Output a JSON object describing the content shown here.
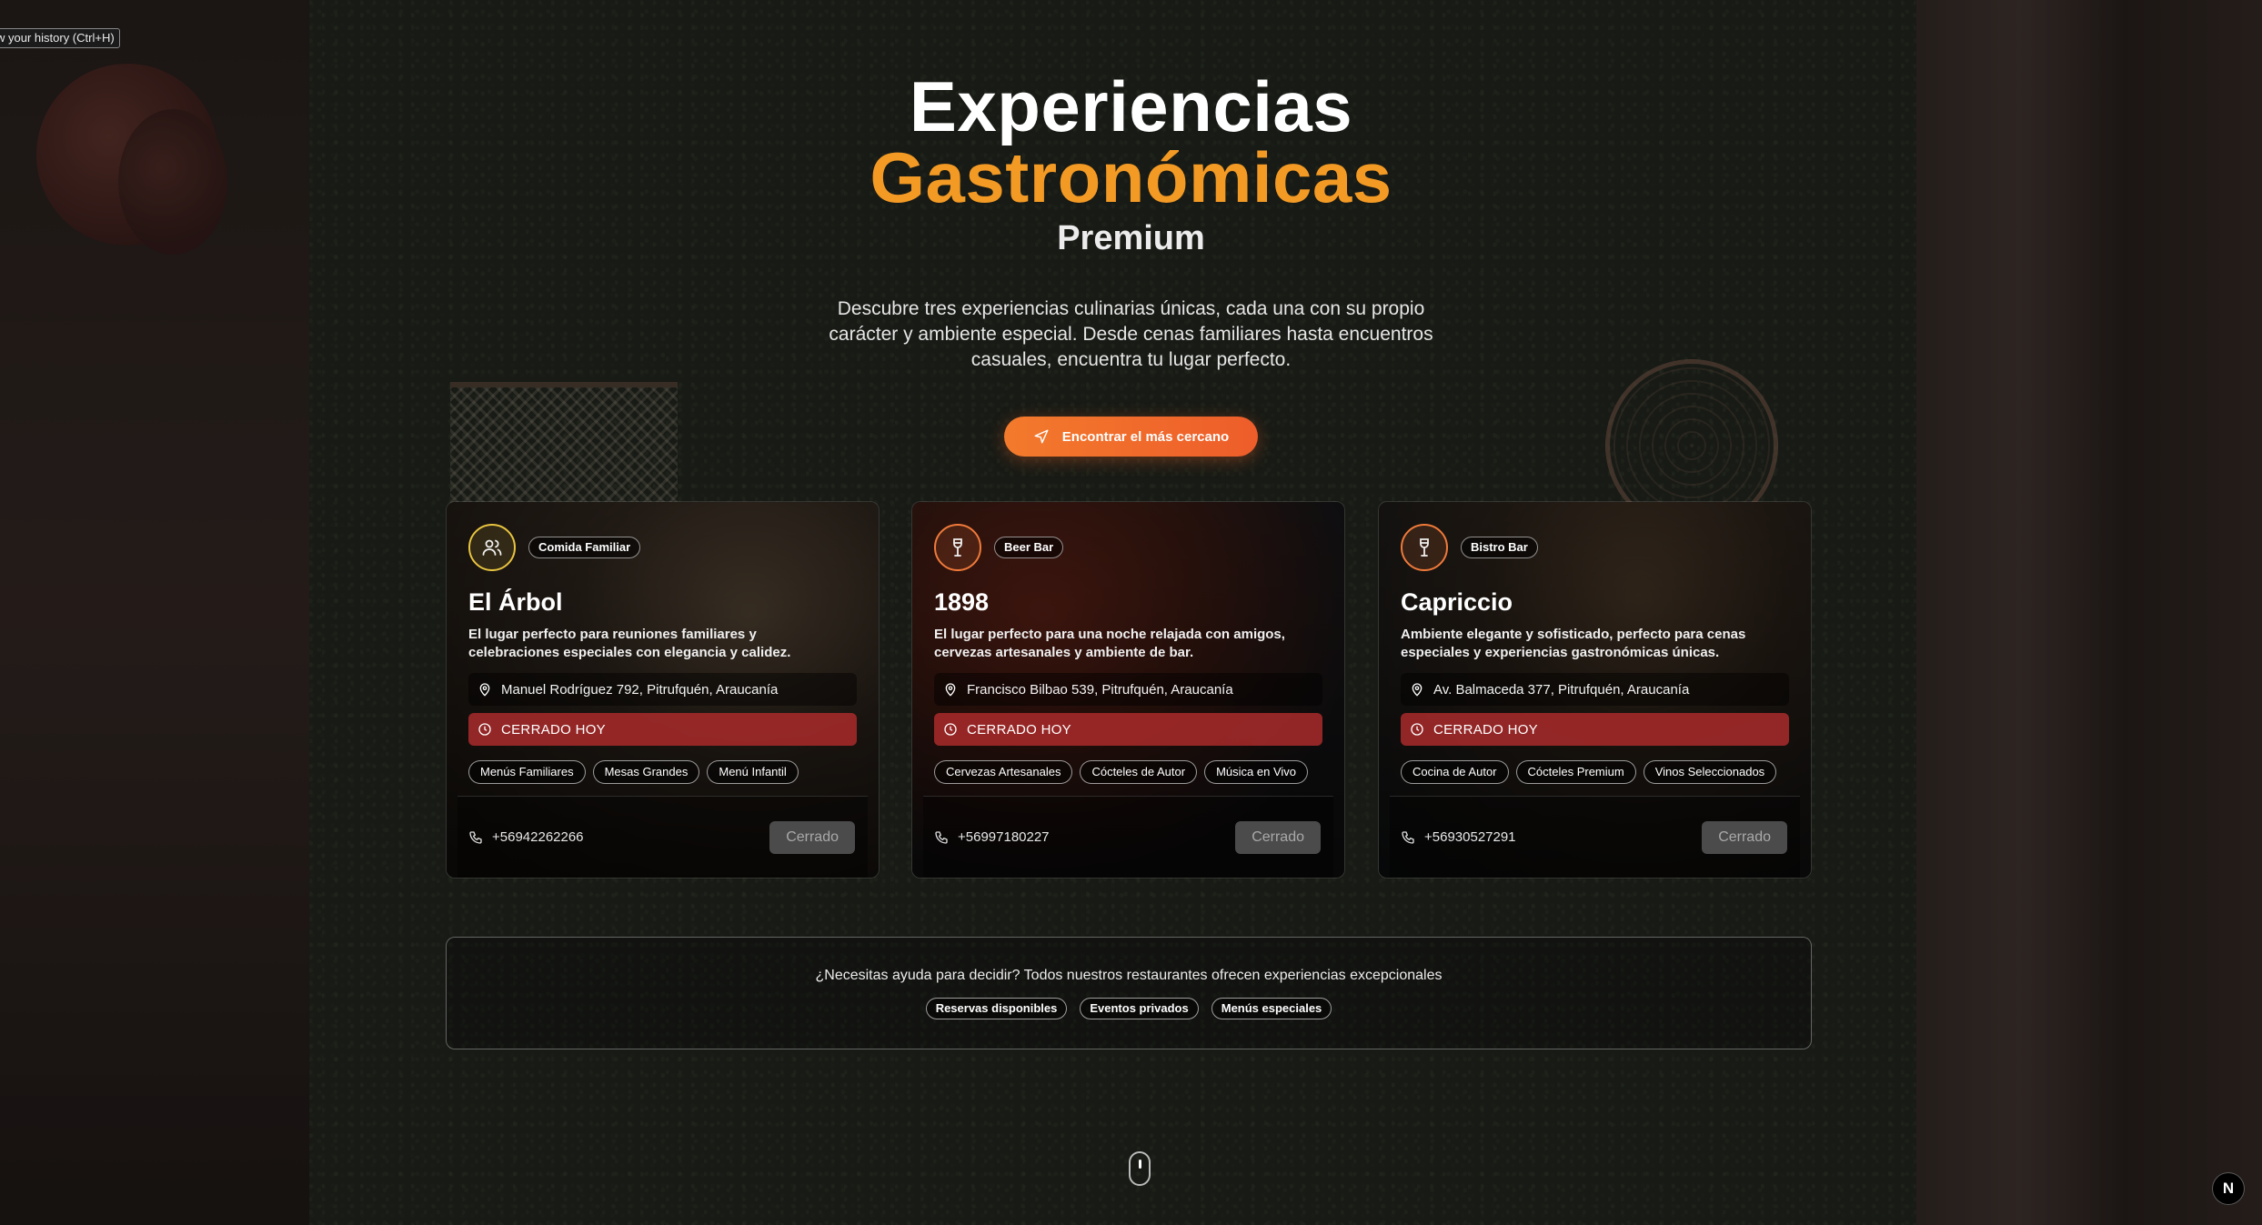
{
  "tooltip": {
    "text": "w your history (Ctrl+H)"
  },
  "hero": {
    "title_line1": "Experiencias",
    "title_line2": "Gastronómicas",
    "title_line3": "Premium",
    "description": "Descubre tres experiencias culinarias únicas, cada una con su propio carácter y ambiente especial. Desde cenas familiares hasta encuentros casuales, encuentra tu lugar perfecto.",
    "cta_label": "Encontrar el más cercano",
    "cta_icon": "navigation-arrow-icon",
    "accent_color": "#f39a25"
  },
  "restaurants": [
    {
      "icon": "users-icon",
      "icon_color": "#e8c440",
      "category": "Comida Familiar",
      "name": "El Árbol",
      "description": "El lugar perfecto para reuniones familiares y celebraciones especiales con elegancia y calidez.",
      "address": "Manuel Rodríguez 792, Pitrufquén, Araucanía",
      "status": "CERRADO HOY",
      "features": [
        "Menús Familiares",
        "Mesas Grandes",
        "Menú Infantil"
      ],
      "phone": "+56942262266",
      "button_label": "Cerrado"
    },
    {
      "icon": "wine-glass-icon",
      "icon_color": "#f07a3a",
      "category": "Beer Bar",
      "name": "1898",
      "description": "El lugar perfecto para una noche relajada con amigos, cervezas artesanales y ambiente de bar.",
      "address": "Francisco Bilbao 539, Pitrufquén, Araucanía",
      "status": "CERRADO HOY",
      "features": [
        "Cervezas Artesanales",
        "Cócteles de Autor",
        "Música en Vivo"
      ],
      "phone": "+56997180227",
      "button_label": "Cerrado"
    },
    {
      "icon": "wine-glass-icon",
      "icon_color": "#f07a3a",
      "category": "Bistro Bar",
      "name": "Capriccio",
      "description": "Ambiente elegante y sofisticado, perfecto para cenas especiales y experiencias gastronómicas únicas.",
      "address": "Av. Balmaceda 377, Pitrufquén, Araucanía",
      "status": "CERRADO HOY",
      "features": [
        "Cocina de Autor",
        "Cócteles Premium",
        "Vinos Seleccionados"
      ],
      "phone": "+56930527291",
      "button_label": "Cerrado"
    }
  ],
  "help": {
    "text": "¿Necesitas ayuda para decidir? Todos nuestros restaurantes ofrecen experiencias excepcionales",
    "chips": [
      "Reservas disponibles",
      "Eventos privados",
      "Menús especiales"
    ]
  },
  "next_badge": "N"
}
